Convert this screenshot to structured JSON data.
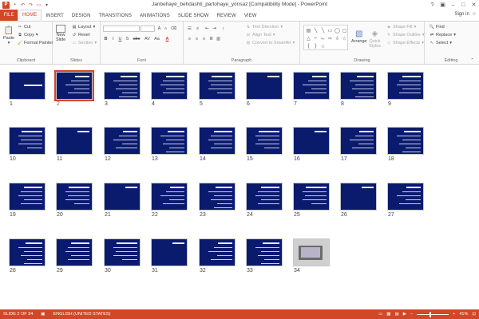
{
  "window": {
    "title": "Janbehaye_behdashti_partohaye_yonsaz [Compatibility Mode] - PowerPoint",
    "controls": [
      "?",
      "–",
      "□",
      "✕"
    ]
  },
  "tabs": [
    "FILE",
    "HOME",
    "INSERT",
    "DESIGN",
    "TRANSITIONS",
    "ANIMATIONS",
    "SLIDE SHOW",
    "REVIEW",
    "VIEW"
  ],
  "active_tab": "HOME",
  "signin": "Sign in",
  "ribbon": {
    "clipboard": {
      "paste": "Paste",
      "cut": "Cut",
      "copy": "Copy",
      "format_painter": "Format Painter",
      "label": "Clipboard"
    },
    "slides": {
      "new_slide": "New",
      "new_slide_2": "Slide",
      "layout": "Layout",
      "reset": "Reset",
      "section": "Section",
      "label": "Slides"
    },
    "font": {
      "label": "Font",
      "buttons": [
        "B",
        "I",
        "U",
        "S",
        "abc",
        "AV",
        "Aa",
        "A"
      ]
    },
    "paragraph": {
      "text_direction": "Text Direction",
      "align_text": "Align Text",
      "convert_smartart": "Convert to SmartArt",
      "label": "Paragraph"
    },
    "drawing": {
      "arrange": "Arrange",
      "quick_styles": "Quick",
      "quick_styles_2": "Styles",
      "shape_fill": "Shape Fill",
      "shape_outline": "Shape Outline",
      "shape_effects": "Shape Effects",
      "label": "Drawing"
    },
    "editing": {
      "find": "Find",
      "replace": "Replace",
      "select": "Select",
      "label": "Editing"
    }
  },
  "slides": [
    {
      "num": "1"
    },
    {
      "num": "2",
      "selected": true
    },
    {
      "num": "3"
    },
    {
      "num": "4"
    },
    {
      "num": "5"
    },
    {
      "num": "6"
    },
    {
      "num": "7"
    },
    {
      "num": "8"
    },
    {
      "num": "9"
    },
    {
      "num": "10"
    },
    {
      "num": "11"
    },
    {
      "num": "12"
    },
    {
      "num": "13"
    },
    {
      "num": "14"
    },
    {
      "num": "15"
    },
    {
      "num": "16"
    },
    {
      "num": "17"
    },
    {
      "num": "18"
    },
    {
      "num": "19"
    },
    {
      "num": "20"
    },
    {
      "num": "21"
    },
    {
      "num": "22"
    },
    {
      "num": "23"
    },
    {
      "num": "24"
    },
    {
      "num": "25"
    },
    {
      "num": "26"
    },
    {
      "num": "27"
    },
    {
      "num": "28"
    },
    {
      "num": "29"
    },
    {
      "num": "30"
    },
    {
      "num": "31"
    },
    {
      "num": "32"
    },
    {
      "num": "33"
    },
    {
      "num": "34",
      "photo": true
    }
  ],
  "status": {
    "slide_of": "SLIDE 2 OF 34",
    "language": "ENGLISH (UNITED STATES)",
    "zoom": "41%",
    "zoom_value": 41
  },
  "colors": {
    "accent": "#d24726",
    "slide_bg": "#0a1b6e"
  }
}
